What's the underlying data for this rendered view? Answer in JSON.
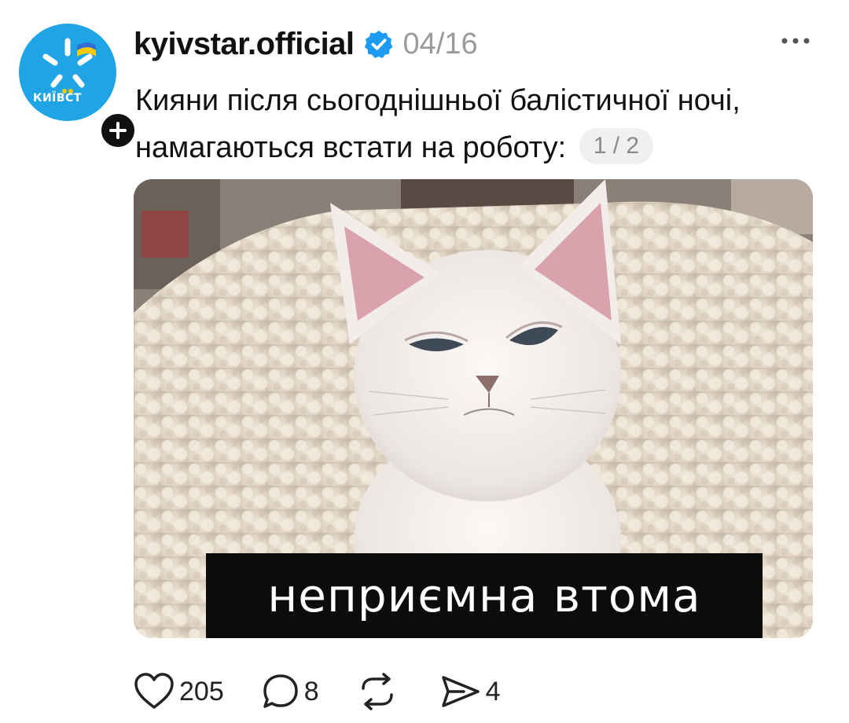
{
  "post": {
    "author": {
      "username": "kyivstar.official",
      "avatar_brand_text": "КИЇВСТ",
      "verified": true,
      "verified_color": "#1d9bf0",
      "avatar_color": "#1fa4e6"
    },
    "date": "04/16",
    "caption_lines": [
      "Кияни після сьогоднішньої балістичної ночі,",
      "намагаються встати на роботу:"
    ],
    "carousel_indicator": "1/2",
    "media": {
      "meme_caption": "неприємна втома"
    },
    "actions": {
      "likes": "205",
      "replies": "8",
      "reposts": "",
      "shares": "4"
    },
    "icons": {
      "more": "more-dots-icon",
      "follow": "plus-icon",
      "like": "heart-icon",
      "reply": "comment-icon",
      "repost": "repost-icon",
      "share": "send-icon"
    }
  }
}
